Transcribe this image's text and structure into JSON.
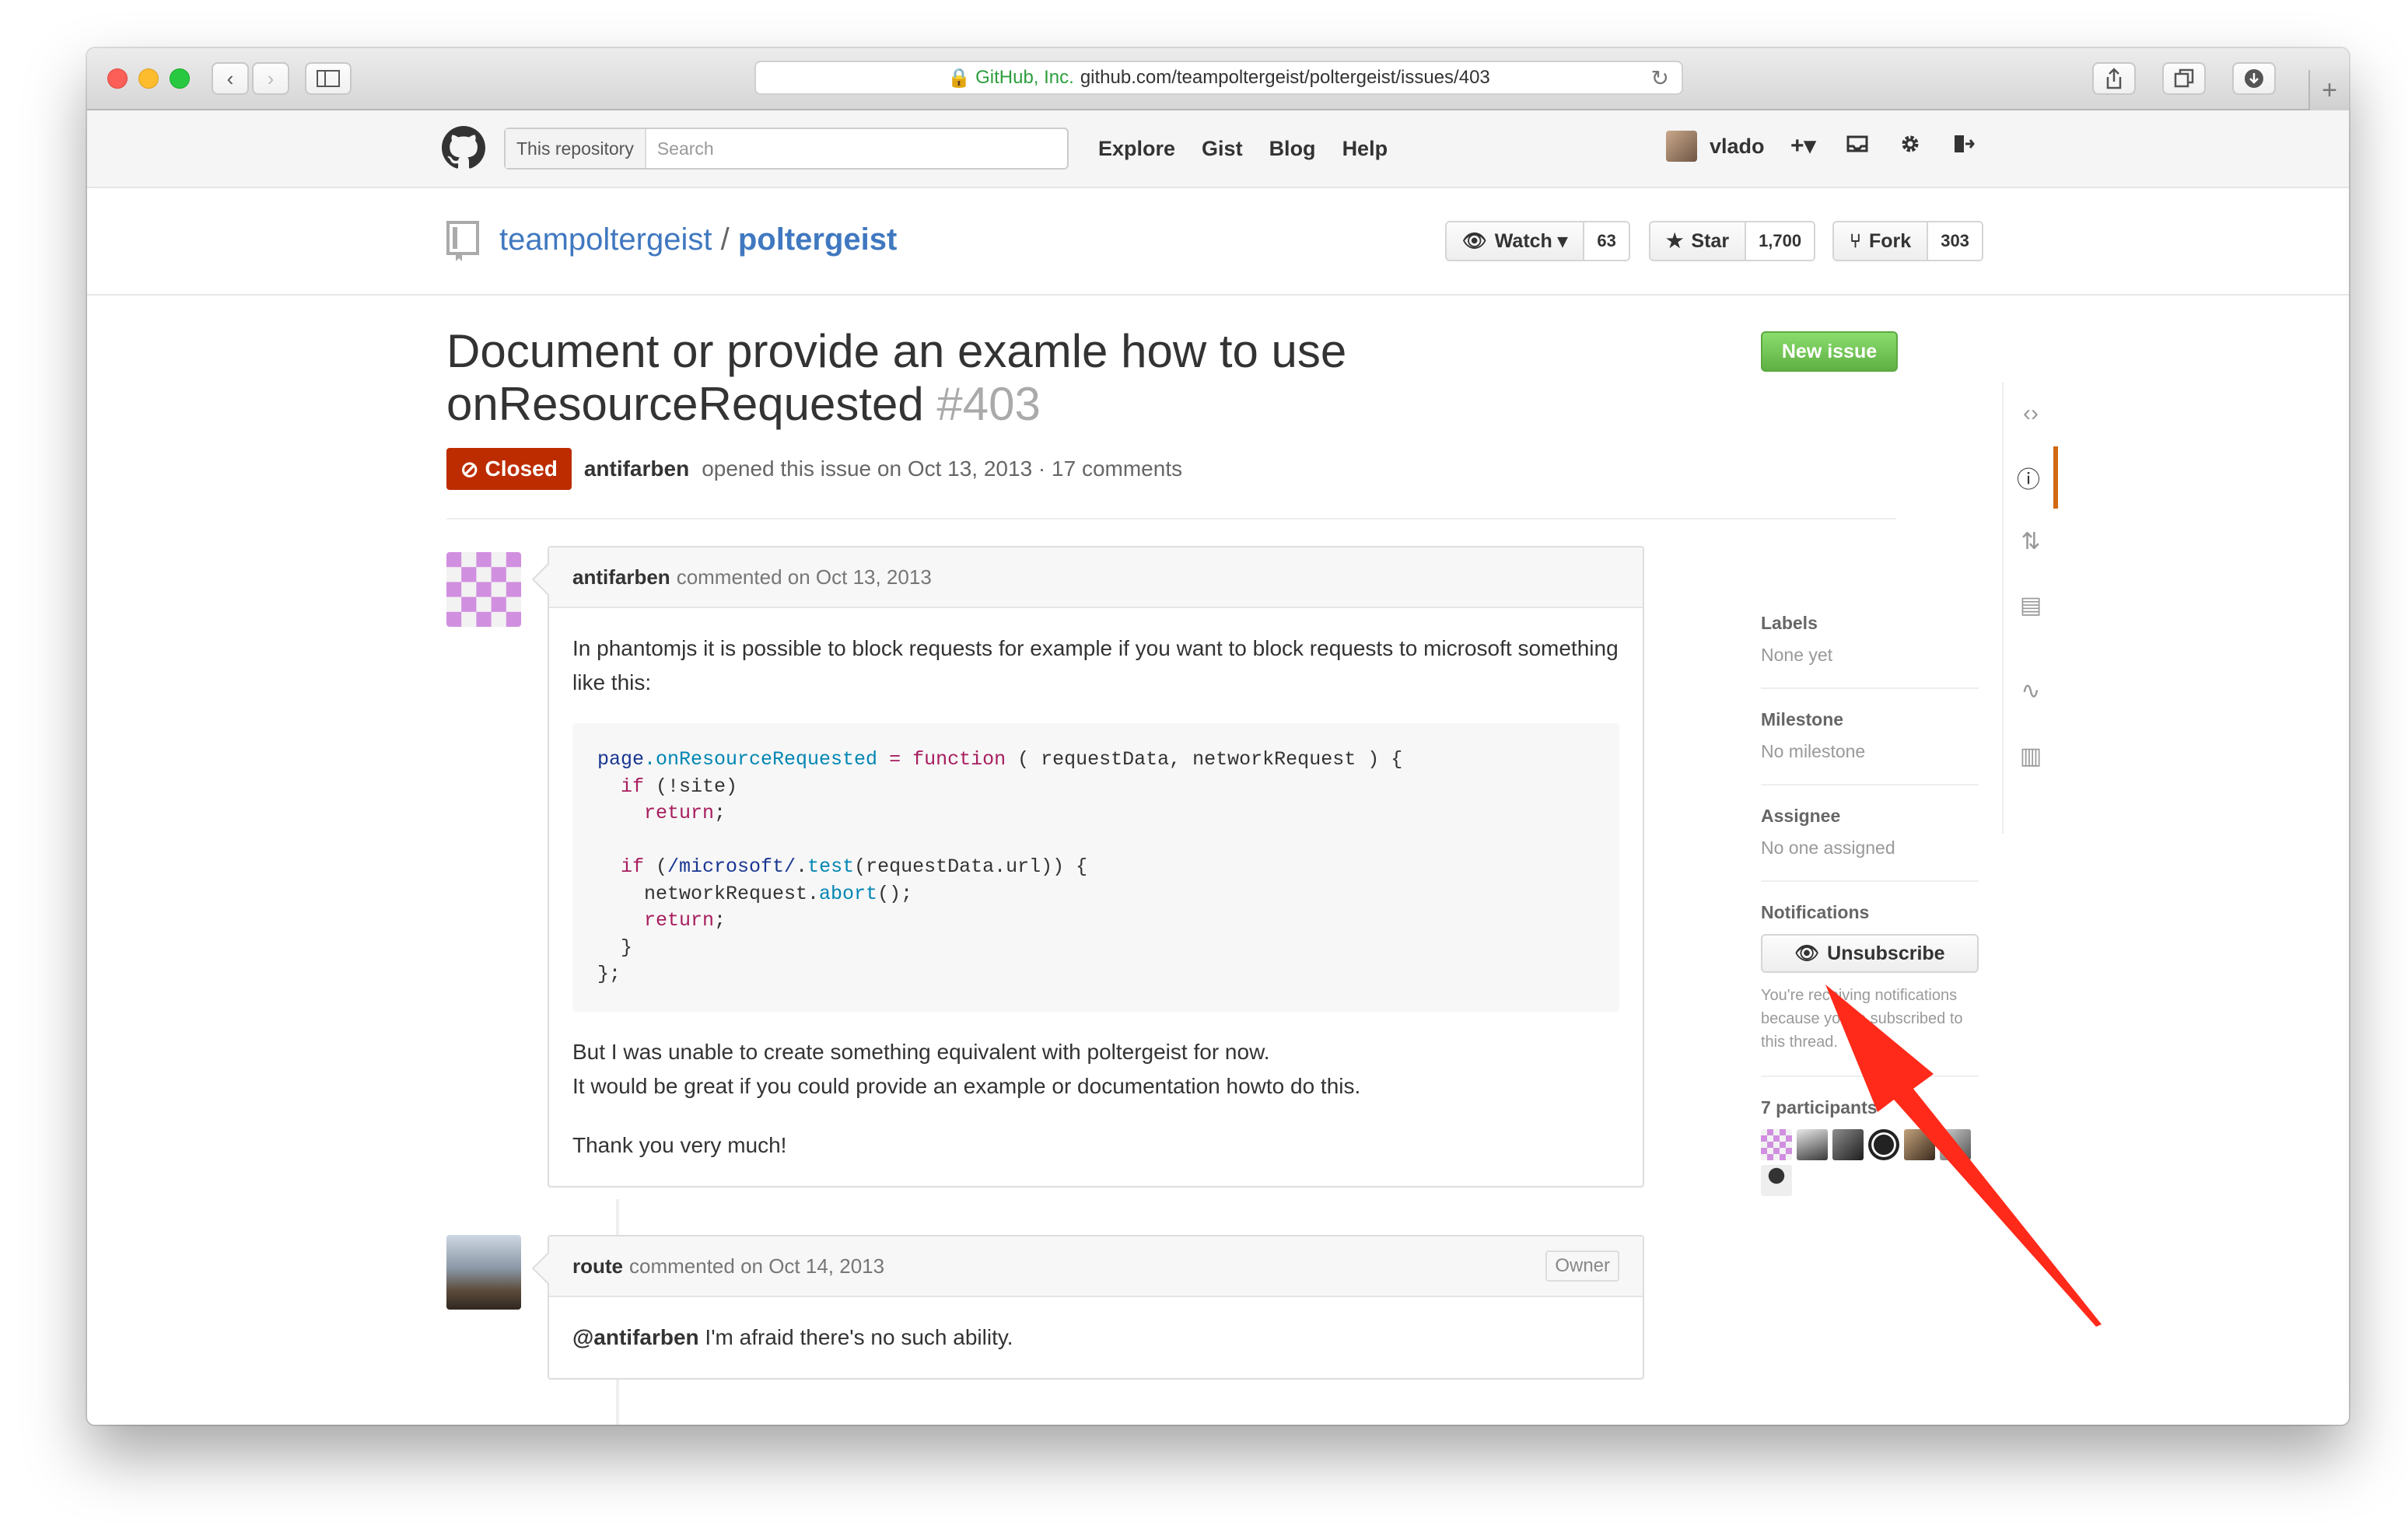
{
  "browser": {
    "url_secure_label": "GitHub, Inc.",
    "url_text": "github.com/teampoltergeist/poltergeist/issues/403",
    "back_icon": "‹",
    "forward_icon": "›",
    "newtab_icon": "+"
  },
  "header": {
    "search_scope": "This repository",
    "search_placeholder": "Search",
    "nav": [
      "Explore",
      "Gist",
      "Blog",
      "Help"
    ],
    "username": "vlado",
    "plus_label": "+▾"
  },
  "repo": {
    "owner": "teampoltergeist",
    "separator": "/",
    "name": "poltergeist",
    "watch_label": "Watch ▾",
    "watch_count": "63",
    "star_label": "Star",
    "star_count": "1,700",
    "fork_label": "Fork",
    "fork_count": "303"
  },
  "issue": {
    "title_line1": "Document or provide an examle how to use",
    "title_line2": "onResourceRequested",
    "number": "#403",
    "new_issue_label": "New issue",
    "state": "Closed",
    "author": "antifarben",
    "opened_text": "opened this issue on Oct 13, 2013 · 17 comments"
  },
  "comments": [
    {
      "author": "antifarben",
      "when": "commented on Oct 13, 2013",
      "p1": "In phantomjs it is possible to block requests for example if you want to block requests to microsoft something like this:",
      "p2_line1": "But I was unable to create something equivalent with poltergeist for now.",
      "p2_line2": "It would be great if you could provide an example or documentation howto do this.",
      "p3": "Thank you very much!"
    },
    {
      "author": "route",
      "when": "commented on Oct 14, 2013",
      "owner_badge": "Owner",
      "mention": "@antifarben",
      "text_after": " I'm afraid there's no such ability."
    }
  ],
  "code": {
    "l1_a": "page",
    "l1_b": ".onResourceRequested",
    "l1_c": " = ",
    "l1_d": "function",
    "l1_e": " ( requestData, networkRequest ) {",
    "l2_a": "  if",
    "l2_b": " (!site)",
    "l3": "    return",
    "l3_b": ";",
    "l5_a": "  if",
    "l5_b": " (",
    "l5_c": "/microsoft/",
    "l5_d": ".",
    "l5_e": "test",
    "l5_f": "(requestData.url)) {",
    "l6_a": "    networkRequest.",
    "l6_b": "abort",
    "l6_c": "();",
    "l7": "    return",
    "l7_b": ";",
    "l8": "  }",
    "l9": "};"
  },
  "sidebar": {
    "labels_title": "Labels",
    "labels_value": "None yet",
    "milestone_title": "Milestone",
    "milestone_value": "No milestone",
    "assignee_title": "Assignee",
    "assignee_value": "No one assigned",
    "notifications_title": "Notifications",
    "unsubscribe_label": "Unsubscribe",
    "notifications_note": "You're receiving notifications because you're subscribed to this thread.",
    "participants_title": "7 participants"
  },
  "colors": {
    "accent_link": "#4078c0",
    "closed_red": "#bd2c00",
    "new_issue_green": "#6cc644",
    "arrow_red": "#ff2a1a"
  }
}
